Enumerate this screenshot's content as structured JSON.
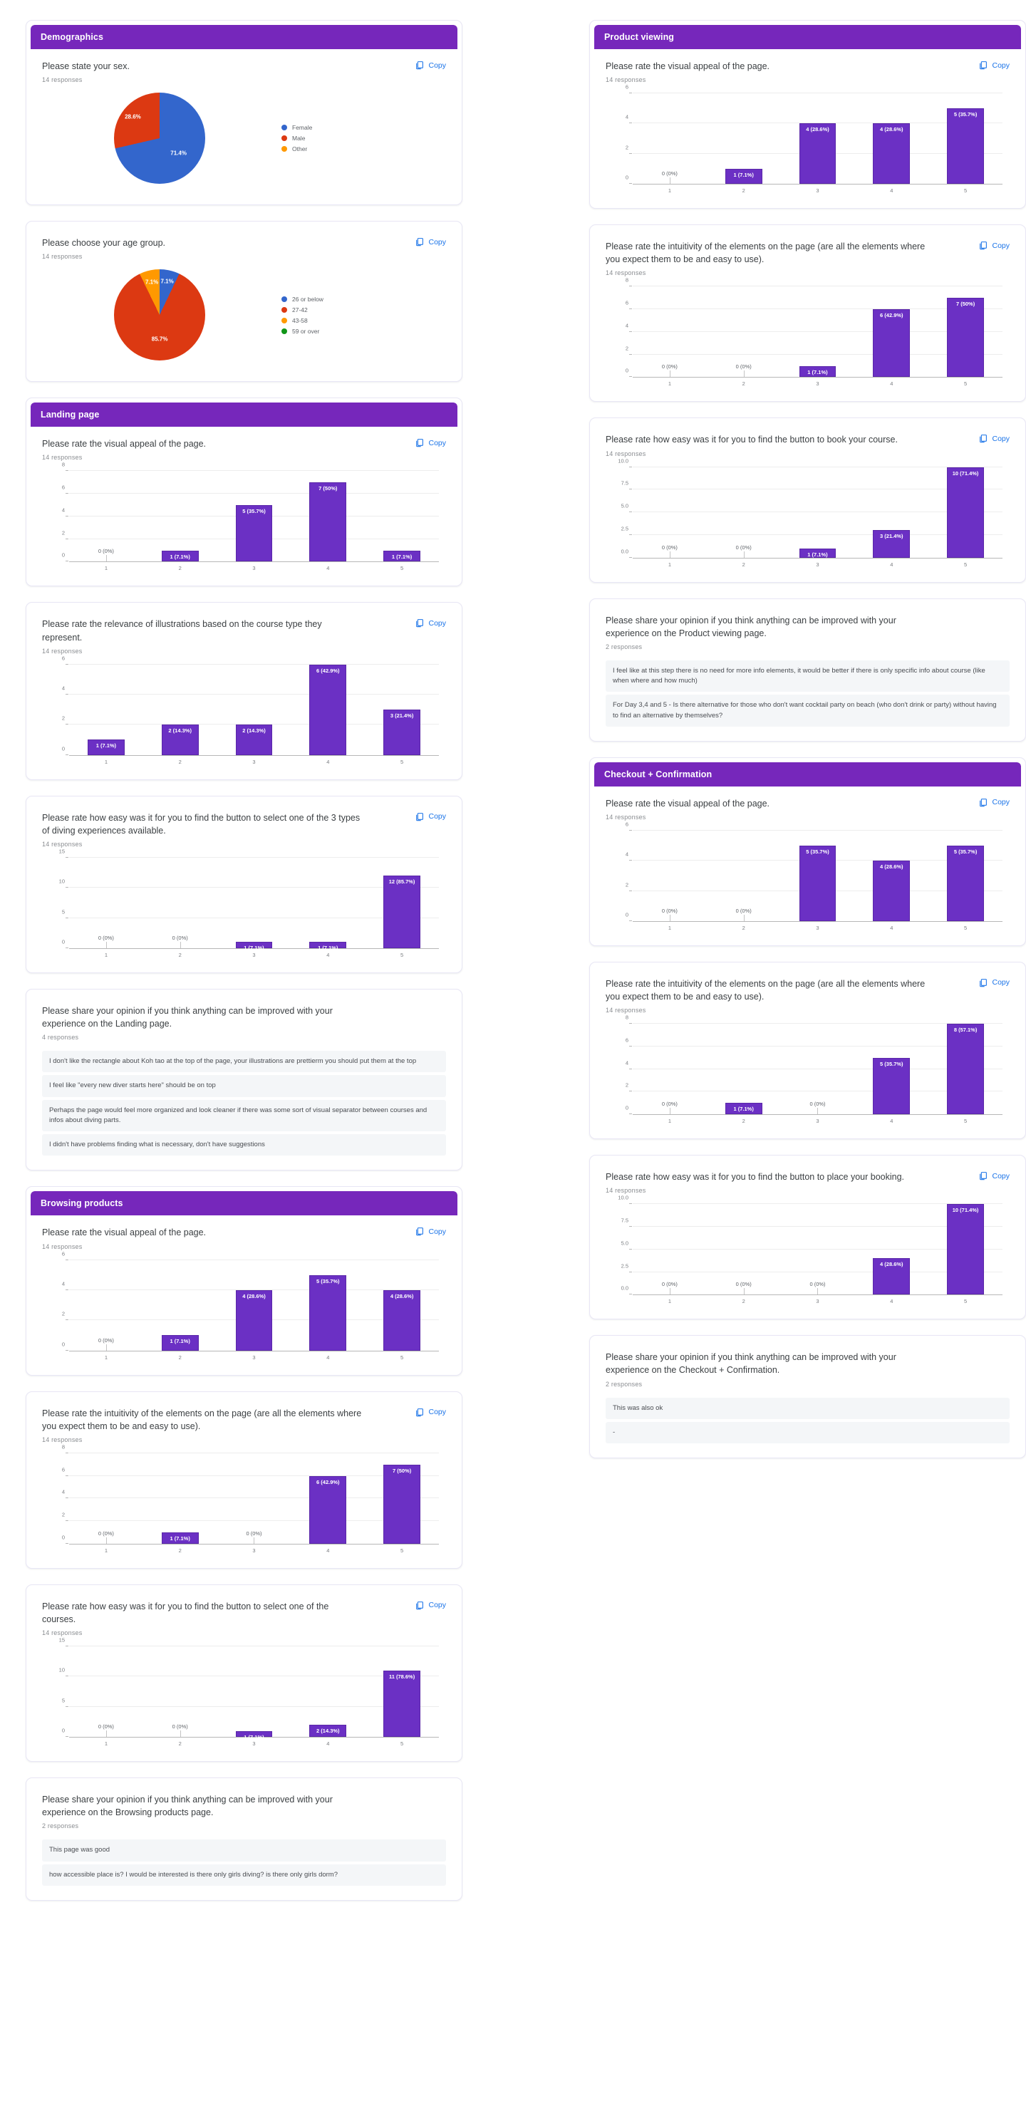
{
  "ui": {
    "copy_label": "Copy",
    "copy_icon": "copy-icon",
    "accent_purple": "#7627bb",
    "bar_purple": "#6b30c4",
    "link_blue": "#1a73e8"
  },
  "sections": {
    "demographics": "Demographics",
    "landing_page": "Landing page",
    "browsing_products": "Browsing products",
    "product_viewing": "Product viewing",
    "checkout_confirmation": "Checkout + Confirmation"
  },
  "chart_data": [
    {
      "id": "sex",
      "type": "pie",
      "title": "Please state your sex.",
      "responses": "14 responses",
      "labels": [
        "Female",
        "Male",
        "Other"
      ],
      "values": [
        71.4,
        28.6,
        0
      ],
      "slice_labels": [
        "71.4%",
        "28.6%"
      ],
      "colors": [
        "#3366cc",
        "#dc3912",
        "#ff9900"
      ],
      "legend_position": "right"
    },
    {
      "id": "age",
      "type": "pie",
      "title": "Please choose your age group.",
      "responses": "14 responses",
      "labels": [
        "26 or below",
        "27-42",
        "43-58",
        "59 or over"
      ],
      "values": [
        7.1,
        85.7,
        7.1,
        0
      ],
      "slice_labels": [
        "85.7%",
        "7.1%",
        "7.1%"
      ],
      "colors": [
        "#3366cc",
        "#dc3912",
        "#ff9900",
        "#109618"
      ],
      "legend_position": "right"
    },
    {
      "id": "lp-visual",
      "type": "bar",
      "title": "Please rate the visual appeal of the page.",
      "responses": "14 responses",
      "categories": [
        "1",
        "2",
        "3",
        "4",
        "5"
      ],
      "values": [
        0,
        1,
        5,
        7,
        1
      ],
      "bar_labels": [
        "0 (0%)",
        "1 (7.1%)",
        "5 (35.7%)",
        "7 (50%)",
        "1 (7.1%)"
      ],
      "yticks": [
        0,
        2,
        4,
        6,
        8
      ],
      "ylim": [
        0,
        8
      ],
      "ylabel": "",
      "xlabel": "",
      "grid": true
    },
    {
      "id": "lp-illustrations",
      "type": "bar",
      "title": "Please rate the relevance of illustrations based on the course type they represent.",
      "responses": "14 responses",
      "categories": [
        "1",
        "2",
        "3",
        "4",
        "5"
      ],
      "values": [
        1,
        2,
        2,
        6,
        3
      ],
      "bar_labels": [
        "1 (7.1%)",
        "2 (14.3%)",
        "2 (14.3%)",
        "6 (42.9%)",
        "3 (21.4%)"
      ],
      "yticks": [
        0,
        2,
        4,
        6
      ],
      "ylim": [
        0,
        6
      ],
      "ylabel": "",
      "xlabel": "",
      "grid": true
    },
    {
      "id": "lp-diving-button",
      "type": "bar",
      "title": "Please rate how easy was it for you to find the button to select one of the 3 types of diving experiences available.",
      "responses": "14 responses",
      "categories": [
        "1",
        "2",
        "3",
        "4",
        "5"
      ],
      "values": [
        0,
        0,
        1,
        1,
        12
      ],
      "bar_labels": [
        "0 (0%)",
        "0 (0%)",
        "1 (7.1%)",
        "1 (7.1%)",
        "12 (85.7%)"
      ],
      "yticks": [
        0,
        5,
        10,
        15
      ],
      "ylim": [
        0,
        15
      ],
      "ylabel": "",
      "xlabel": "",
      "grid": true
    },
    {
      "id": "bp-visual",
      "type": "bar",
      "title": "Please rate the visual appeal of the page.",
      "responses": "14 responses",
      "categories": [
        "1",
        "2",
        "3",
        "4",
        "5"
      ],
      "values": [
        0,
        1,
        4,
        5,
        4
      ],
      "bar_labels": [
        "0 (0%)",
        "1 (7.1%)",
        "4 (28.6%)",
        "5 (35.7%)",
        "4 (28.6%)"
      ],
      "yticks": [
        0,
        2,
        4,
        6
      ],
      "ylim": [
        0,
        6
      ],
      "ylabel": "",
      "xlabel": "",
      "grid": true
    },
    {
      "id": "bp-intuitivity",
      "type": "bar",
      "title": "Please rate the intuitivity of the elements on the page (are all the elements where you expect them to be and easy to use).",
      "responses": "14 responses",
      "categories": [
        "1",
        "2",
        "3",
        "4",
        "5"
      ],
      "values": [
        0,
        1,
        0,
        6,
        7
      ],
      "bar_labels": [
        "0 (0%)",
        "1 (7.1%)",
        "0 (0%)",
        "6 (42.9%)",
        "7 (50%)"
      ],
      "yticks": [
        0,
        2,
        4,
        6,
        8
      ],
      "ylim": [
        0,
        8
      ],
      "ylabel": "",
      "xlabel": "",
      "grid": true
    },
    {
      "id": "bp-course-button",
      "type": "bar",
      "title": "Please rate how easy was it for you to find the button to select one of the courses.",
      "responses": "14 responses",
      "categories": [
        "1",
        "2",
        "3",
        "4",
        "5"
      ],
      "values": [
        0,
        0,
        1,
        2,
        11
      ],
      "bar_labels": [
        "0 (0%)",
        "0 (0%)",
        "1 (7.1%)",
        "2 (14.3%)",
        "11 (78.6%)"
      ],
      "yticks": [
        0,
        5,
        10,
        15
      ],
      "ylim": [
        0,
        15
      ],
      "ylabel": "",
      "xlabel": "",
      "grid": true
    },
    {
      "id": "pv-visual",
      "type": "bar",
      "title": "Please rate the visual appeal of the page.",
      "responses": "14 responses",
      "categories": [
        "1",
        "2",
        "3",
        "4",
        "5"
      ],
      "values": [
        0,
        1,
        4,
        4,
        5
      ],
      "bar_labels": [
        "0 (0%)",
        "1 (7.1%)",
        "4 (28.6%)",
        "4 (28.6%)",
        "5 (35.7%)"
      ],
      "yticks": [
        0,
        2,
        4,
        6
      ],
      "ylim": [
        0,
        6
      ],
      "ylabel": "",
      "xlabel": "",
      "grid": true
    },
    {
      "id": "pv-intuitivity",
      "type": "bar",
      "title": "Please rate the intuitivity of the elements on the page (are all the elements where you expect them to be and easy to use).",
      "responses": "14 responses",
      "categories": [
        "1",
        "2",
        "3",
        "4",
        "5"
      ],
      "values": [
        0,
        0,
        1,
        6,
        7
      ],
      "bar_labels": [
        "0 (0%)",
        "0 (0%)",
        "1 (7.1%)",
        "6 (42.9%)",
        "7 (50%)"
      ],
      "yticks": [
        0,
        2,
        4,
        6,
        8
      ],
      "ylim": [
        0,
        8
      ],
      "ylabel": "",
      "xlabel": "",
      "grid": true
    },
    {
      "id": "pv-book-button",
      "type": "bar",
      "title": "Please rate how easy was it for you to find the button to book your course.",
      "responses": "14 responses",
      "categories": [
        "1",
        "2",
        "3",
        "4",
        "5"
      ],
      "values": [
        0,
        0,
        1,
        3,
        10
      ],
      "bar_labels": [
        "0 (0%)",
        "0 (0%)",
        "1 (7.1%)",
        "3 (21.4%)",
        "10 (71.4%)"
      ],
      "yticks": [
        "0.0",
        "2.5",
        "5.0",
        "7.5",
        "10.0"
      ],
      "ylim": [
        0,
        10
      ],
      "ylabel": "",
      "xlabel": "",
      "grid": true
    },
    {
      "id": "cc-visual",
      "type": "bar",
      "title": "Please rate the visual appeal of the page.",
      "responses": "14 responses",
      "categories": [
        "1",
        "2",
        "3",
        "4",
        "5"
      ],
      "values": [
        0,
        0,
        5,
        4,
        5
      ],
      "bar_labels": [
        "0 (0%)",
        "0 (0%)",
        "5 (35.7%)",
        "4 (28.6%)",
        "5 (35.7%)"
      ],
      "yticks": [
        0,
        2,
        4,
        6
      ],
      "ylim": [
        0,
        6
      ],
      "ylabel": "",
      "xlabel": "",
      "grid": true
    },
    {
      "id": "cc-intuitivity",
      "type": "bar",
      "title": "Please rate the intuitivity of the elements on the page (are all the elements where you expect them to be and easy to use).",
      "responses": "14 responses",
      "categories": [
        "1",
        "2",
        "3",
        "4",
        "5"
      ],
      "values": [
        0,
        1,
        0,
        5,
        8
      ],
      "bar_labels": [
        "0 (0%)",
        "1 (7.1%)",
        "0 (0%)",
        "5 (35.7%)",
        "8 (57.1%)"
      ],
      "yticks": [
        0,
        2,
        4,
        6,
        8
      ],
      "ylim": [
        0,
        8
      ],
      "ylabel": "",
      "xlabel": "",
      "grid": true
    },
    {
      "id": "cc-booking-button",
      "type": "bar",
      "title": "Please rate how easy was it for you to find the button to place your booking.",
      "responses": "14 responses",
      "categories": [
        "1",
        "2",
        "3",
        "4",
        "5"
      ],
      "values": [
        0,
        0,
        0,
        4,
        10
      ],
      "bar_labels": [
        "0 (0%)",
        "0 (0%)",
        "0 (0%)",
        "4 (28.6%)",
        "10 (71.4%)"
      ],
      "yticks": [
        "0.0",
        "2.5",
        "5.0",
        "7.5",
        "10.0"
      ],
      "ylim": [
        0,
        10
      ],
      "ylabel": "",
      "xlabel": "",
      "grid": true
    }
  ],
  "text_questions": [
    {
      "id": "lp-opinion",
      "title": "Please share your opinion if you think anything can be improved with your experience on the Landing page.",
      "responses": "4 responses",
      "answers": [
        "I don't like the rectangle about Koh tao at the top of the page, your illustrations are prettierm you should put them at the top",
        "I feel like \"every new diver starts here\" should be on top",
        "Perhaps the page would feel more organized and look cleaner if there was some sort of visual separator between courses and infos about diving parts.",
        "I didn't have problems finding what is necessary, don't have suggestions"
      ]
    },
    {
      "id": "bp-opinion",
      "title": "Please share your opinion if you think anything can be improved with your experience on the Browsing products page.",
      "responses": "2 responses",
      "answers": [
        "This page was good",
        "how accessible place is? I would be interested is there only girls diving? is there only girls dorm?"
      ]
    },
    {
      "id": "pv-opinion",
      "title": "Please share your opinion if you think anything can be improved with your experience on the Product viewing page.",
      "responses": "2 responses",
      "answers": [
        "I feel like at this step there is no need for more info elements, it would be better if there is only specific info about course (like when where and how much)",
        "For Day 3,4 and 5 - Is there alternative for those who don't want cocktail party on beach (who don't drink or party) without having to find an alternative by themselves?"
      ]
    },
    {
      "id": "cc-opinion",
      "title": "Please share your opinion if you think anything can be improved with your experience on the Checkout + Confirmation.",
      "responses": "2 responses",
      "answers": [
        "This was also ok",
        "-"
      ]
    }
  ]
}
